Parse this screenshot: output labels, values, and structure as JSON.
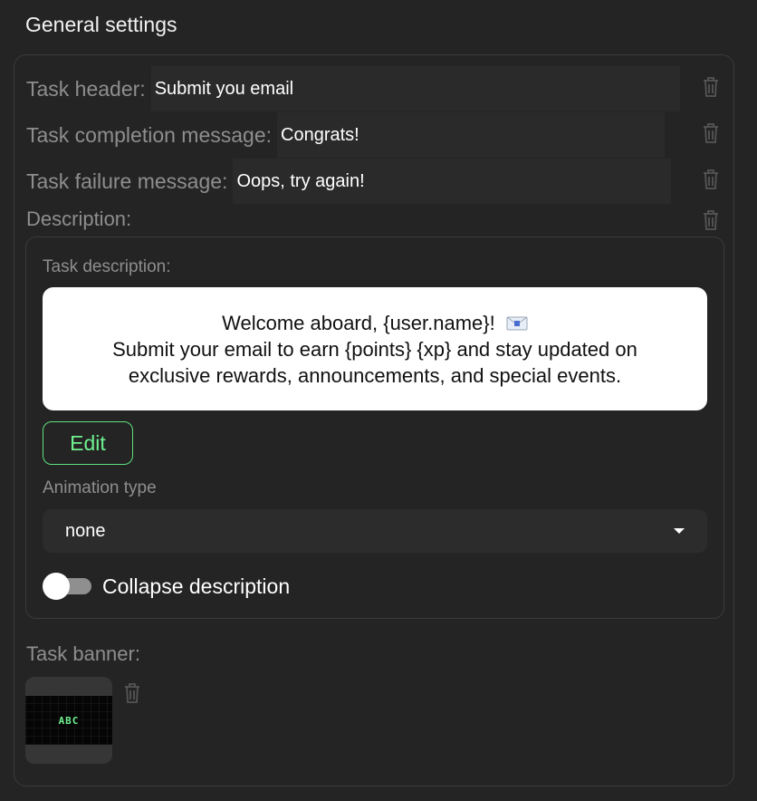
{
  "page": {
    "title": "General settings"
  },
  "fields": {
    "header_label": "Task header:",
    "header_value": "Submit you email",
    "completion_label": "Task completion message:",
    "completion_value": "Congrats!",
    "failure_label": "Task failure message:",
    "failure_value": "Oops, try again!",
    "description_label": "Description:"
  },
  "description": {
    "label": "Task description:",
    "line1": "Welcome aboard, {user.name}!",
    "line1_icon": "envelope-icon",
    "line2": "Submit your email to earn {points} {xp} and stay updated on",
    "line3": "exclusive rewards, announcements, and special events.",
    "edit_label": "Edit",
    "animation_label": "Animation type",
    "animation_value": "none",
    "collapse_label": "Collapse description",
    "collapse_enabled": false
  },
  "banner": {
    "label": "Task banner:",
    "image_text": "ABC"
  },
  "icons": {
    "delete": "trash-icon",
    "dropdown": "caret-down-icon"
  },
  "colors": {
    "background": "#242424",
    "accent": "#6ff08f",
    "muted": "#8e8e8e"
  }
}
